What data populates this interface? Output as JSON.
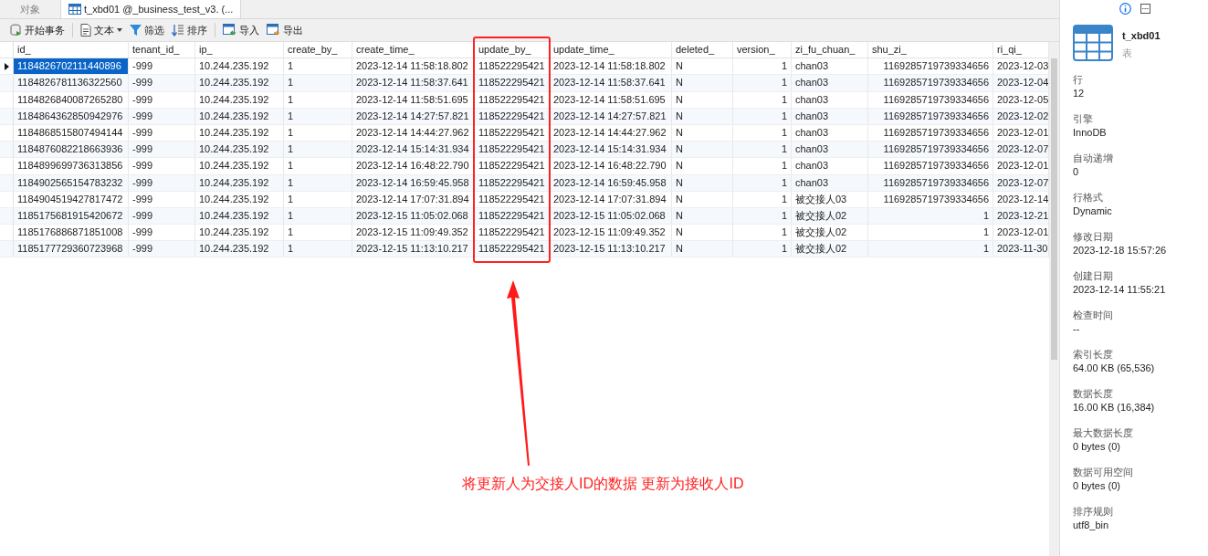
{
  "tabs": [
    {
      "label": "对象",
      "selected": false
    },
    {
      "label": "t_xbd01 @_business_test_v3. (...",
      "selected": true
    }
  ],
  "toolbar": [
    {
      "kind": "transaction",
      "label": "开始事务"
    },
    {
      "kind": "text",
      "label": "文本"
    },
    {
      "kind": "filter",
      "label": "筛选"
    },
    {
      "kind": "sort",
      "label": "排序"
    },
    {
      "kind": "import",
      "label": "导入"
    },
    {
      "kind": "export",
      "label": "导出"
    }
  ],
  "table": {
    "columns": [
      {
        "label": "id_"
      },
      {
        "label": "tenant_id_"
      },
      {
        "label": "ip_"
      },
      {
        "label": "create_by_"
      },
      {
        "label": "create_time_"
      },
      {
        "label": "update_by_"
      },
      {
        "label": "update_time_"
      },
      {
        "label": "deleted_"
      },
      {
        "label": "version_"
      },
      {
        "label": "zi_fu_chuan_"
      },
      {
        "label": "shu_zi_"
      },
      {
        "label": "ri_qi_"
      }
    ],
    "rows": [
      {
        "selected": true,
        "cells": [
          "1184826702111440896",
          "-999",
          "10.244.235.192",
          "1",
          "2023-12-14 11:58:18.802",
          "118522295421",
          "2023-12-14 11:58:18.802",
          "N",
          "1",
          "chan03",
          "1169285719739334656",
          "2023-12-03"
        ]
      },
      {
        "selected": false,
        "cells": [
          "1184826781136322560",
          "-999",
          "10.244.235.192",
          "1",
          "2023-12-14 11:58:37.641",
          "118522295421",
          "2023-12-14 11:58:37.641",
          "N",
          "1",
          "chan03",
          "1169285719739334656",
          "2023-12-04"
        ]
      },
      {
        "selected": false,
        "cells": [
          "1184826840087265280",
          "-999",
          "10.244.235.192",
          "1",
          "2023-12-14 11:58:51.695",
          "118522295421",
          "2023-12-14 11:58:51.695",
          "N",
          "1",
          "chan03",
          "1169285719739334656",
          "2023-12-05"
        ]
      },
      {
        "selected": false,
        "cells": [
          "1184864362850942976",
          "-999",
          "10.244.235.192",
          "1",
          "2023-12-14 14:27:57.821",
          "118522295421",
          "2023-12-14 14:27:57.821",
          "N",
          "1",
          "chan03",
          "1169285719739334656",
          "2023-12-02"
        ]
      },
      {
        "selected": false,
        "cells": [
          "1184868515807494144",
          "-999",
          "10.244.235.192",
          "1",
          "2023-12-14 14:44:27.962",
          "118522295421",
          "2023-12-14 14:44:27.962",
          "N",
          "1",
          "chan03",
          "1169285719739334656",
          "2023-12-01"
        ]
      },
      {
        "selected": false,
        "cells": [
          "1184876082218663936",
          "-999",
          "10.244.235.192",
          "1",
          "2023-12-14 15:14:31.934",
          "118522295421",
          "2023-12-14 15:14:31.934",
          "N",
          "1",
          "chan03",
          "1169285719739334656",
          "2023-12-07"
        ]
      },
      {
        "selected": false,
        "cells": [
          "1184899699736313856",
          "-999",
          "10.244.235.192",
          "1",
          "2023-12-14 16:48:22.790",
          "118522295421",
          "2023-12-14 16:48:22.790",
          "N",
          "1",
          "chan03",
          "1169285719739334656",
          "2023-12-01"
        ]
      },
      {
        "selected": false,
        "cells": [
          "1184902565154783232",
          "-999",
          "10.244.235.192",
          "1",
          "2023-12-14 16:59:45.958",
          "118522295421",
          "2023-12-14 16:59:45.958",
          "N",
          "1",
          "chan03",
          "1169285719739334656",
          "2023-12-07"
        ]
      },
      {
        "selected": false,
        "cells": [
          "1184904519427817472",
          "-999",
          "10.244.235.192",
          "1",
          "2023-12-14 17:07:31.894",
          "118522295421",
          "2023-12-14 17:07:31.894",
          "N",
          "1",
          "被交接人03",
          "1169285719739334656",
          "2023-12-14"
        ]
      },
      {
        "selected": false,
        "cells": [
          "1185175681915420672",
          "-999",
          "10.244.235.192",
          "1",
          "2023-12-15 11:05:02.068",
          "118522295421",
          "2023-12-15 11:05:02.068",
          "N",
          "1",
          "被交接人02",
          "1",
          "2023-12-21"
        ]
      },
      {
        "selected": false,
        "cells": [
          "1185176886871851008",
          "-999",
          "10.244.235.192",
          "1",
          "2023-12-15 11:09:49.352",
          "118522295421",
          "2023-12-15 11:09:49.352",
          "N",
          "1",
          "被交接人02",
          "1",
          "2023-12-01"
        ]
      },
      {
        "selected": false,
        "cells": [
          "1185177729360723968",
          "-999",
          "10.244.235.192",
          "1",
          "2023-12-15 11:13:10.217",
          "118522295421",
          "2023-12-15 11:13:10.217",
          "N",
          "1",
          "被交接人02",
          "1",
          "2023-11-30"
        ]
      }
    ]
  },
  "annotation": {
    "text": "将更新人为交接人ID的数据 更新为接收人ID"
  },
  "info_panel": {
    "name": "t_xbd01",
    "type": "表",
    "fields": [
      {
        "label": "行",
        "value": "12"
      },
      {
        "label": "引擎",
        "value": "InnoDB"
      },
      {
        "label": "自动递增",
        "value": "0"
      },
      {
        "label": "行格式",
        "value": "Dynamic"
      },
      {
        "label": "修改日期",
        "value": "2023-12-18 15:57:26"
      },
      {
        "label": "创建日期",
        "value": "2023-12-14 11:55:21"
      },
      {
        "label": "检查时间",
        "value": "--"
      },
      {
        "label": "索引长度",
        "value": "64.00 KB (65,536)"
      },
      {
        "label": "数据长度",
        "value": "16.00 KB (16,384)"
      },
      {
        "label": "最大数据长度",
        "value": "0 bytes (0)"
      },
      {
        "label": "数据可用空间",
        "value": "0 bytes (0)"
      },
      {
        "label": "排序规则",
        "value": "utf8_bin"
      }
    ]
  }
}
